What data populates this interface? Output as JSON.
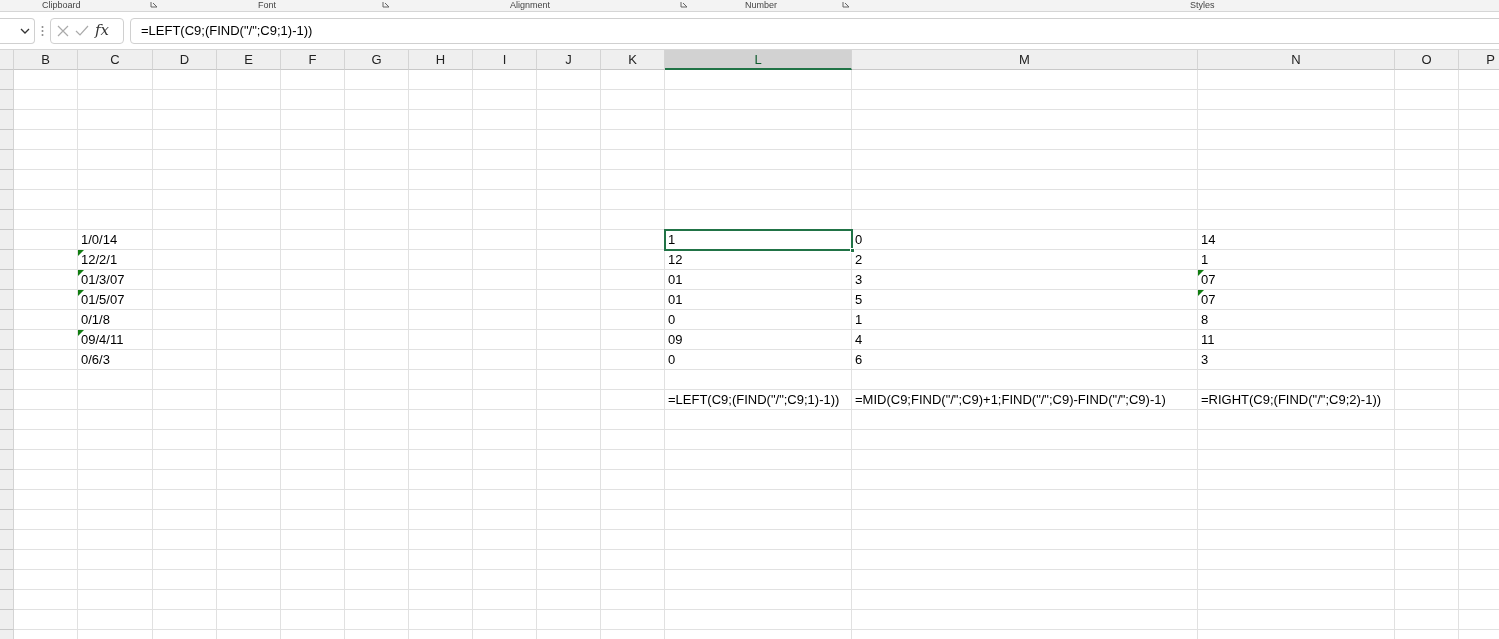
{
  "ribbon_groups": [
    {
      "label": "Clipboard",
      "launcher": true
    },
    {
      "label": "Font",
      "launcher": true
    },
    {
      "label": "Alignment",
      "launcher": true
    },
    {
      "label": "Number",
      "launcher": true
    },
    {
      "label": "Styles",
      "launcher": false
    }
  ],
  "formula_bar": {
    "fx": "fx",
    "formula": "=LEFT(C9;(FIND(\"/\";C9;1)-1))"
  },
  "columns": [
    {
      "label": "B",
      "selected": false
    },
    {
      "label": "C",
      "selected": false
    },
    {
      "label": "D",
      "selected": false
    },
    {
      "label": "E",
      "selected": false
    },
    {
      "label": "F",
      "selected": false
    },
    {
      "label": "G",
      "selected": false
    },
    {
      "label": "H",
      "selected": false
    },
    {
      "label": "I",
      "selected": false
    },
    {
      "label": "J",
      "selected": false
    },
    {
      "label": "K",
      "selected": false
    },
    {
      "label": "L",
      "selected": true
    },
    {
      "label": "M",
      "selected": false
    },
    {
      "label": "N",
      "selected": false
    },
    {
      "label": "O",
      "selected": false
    },
    {
      "label": "P",
      "selected": false
    }
  ],
  "data_rows": [
    {
      "C": {
        "text": "1/0/14",
        "flagged": false
      },
      "L": {
        "text": "1",
        "selected": true
      },
      "M": {
        "text": "0",
        "selected": false
      },
      "N": {
        "text": "14",
        "flagged": false
      }
    },
    {
      "C": {
        "text": "12/2/1",
        "flagged": true
      },
      "L": {
        "text": "12",
        "selected": false
      },
      "M": {
        "text": "2",
        "selected": false
      },
      "N": {
        "text": "1",
        "flagged": false
      }
    },
    {
      "C": {
        "text": "01/3/07",
        "flagged": true
      },
      "L": {
        "text": "01",
        "selected": false
      },
      "M": {
        "text": "3",
        "selected": false
      },
      "N": {
        "text": "07",
        "flagged": true
      }
    },
    {
      "C": {
        "text": "01/5/07",
        "flagged": true
      },
      "L": {
        "text": "01",
        "selected": false
      },
      "M": {
        "text": "5",
        "selected": false
      },
      "N": {
        "text": "07",
        "flagged": true
      }
    },
    {
      "C": {
        "text": "0/1/8",
        "flagged": false
      },
      "L": {
        "text": "0",
        "selected": false
      },
      "M": {
        "text": "1",
        "selected": false
      },
      "N": {
        "text": "8",
        "flagged": false
      }
    },
    {
      "C": {
        "text": "09/4/11",
        "flagged": true
      },
      "L": {
        "text": "09",
        "selected": false
      },
      "M": {
        "text": "4",
        "selected": false
      },
      "N": {
        "text": "11",
        "flagged": false
      }
    },
    {
      "C": {
        "text": "0/6/3",
        "flagged": false
      },
      "L": {
        "text": "0",
        "selected": false
      },
      "M": {
        "text": "6",
        "selected": false
      },
      "N": {
        "text": "3",
        "flagged": false
      }
    }
  ],
  "formula_row": {
    "L": {
      "text": "=LEFT(C9;(FIND(\"/\";C9;1)-1))",
      "selected": false
    },
    "M": {
      "text": "=MID(C9;FIND(\"/\";C9)+1;FIND(\"/\";C9)-FIND(\"/\";C9)-1)",
      "selected": false
    },
    "N": {
      "text": "=RIGHT(C9;(FIND(\"/\";C9;2)-1))",
      "selected": false
    }
  }
}
